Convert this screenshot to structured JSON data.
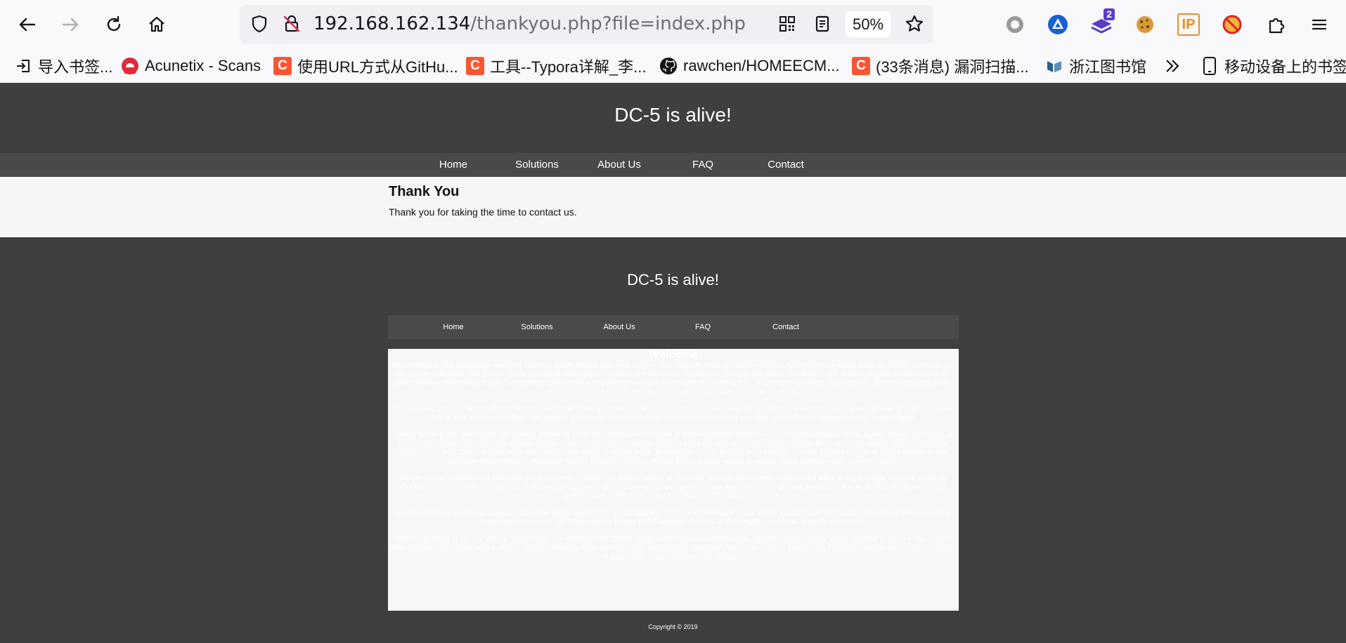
{
  "browser": {
    "url_host": "192.168.162.134",
    "url_path": "/thankyou.php?file=index.php",
    "zoom": "50%",
    "extension_badge": "2",
    "ip_extension_label": "IP",
    "bookmarks": [
      {
        "label": "导入书签...",
        "icon": "import-icon"
      },
      {
        "label": "Acunetix - Scans",
        "icon": "acunetix-icon"
      },
      {
        "label": "使用URL方式从GitHu...",
        "icon": "csdn-icon",
        "icon_text": "C"
      },
      {
        "label": "工具--Typora详解_李...",
        "icon": "csdn-icon",
        "icon_text": "C"
      },
      {
        "label": "rawchen/HOMEECM...",
        "icon": "github-icon"
      },
      {
        "label": "(33条消息) 漏洞扫描...",
        "icon": "csdn-icon",
        "icon_text": "C"
      },
      {
        "label": "浙江图书馆",
        "icon": "library-icon"
      },
      {
        "label": "移动设备上的书签",
        "icon": "mobile-icon"
      }
    ]
  },
  "site": {
    "title": "DC-5 is alive!",
    "nav": [
      "Home",
      "Solutions",
      "About Us",
      "FAQ",
      "Contact"
    ],
    "content": {
      "heading": "Thank You",
      "text": "Thank you for taking the time to contact us."
    },
    "included": {
      "title": "DC-5 is alive!",
      "nav": [
        "Home",
        "Solutions",
        "About Us",
        "FAQ",
        "Contact"
      ],
      "heading": "Welcome",
      "paragraphs": [
        "Duis at dolor a nibh malesuada sagittis id amet orci ipsum. Mauris vitae ante magna. Proin posuere, dolor vel volutpat facilisis, turpis ante malesuada diam, ac efficitur nisi ipsum vel elit. Integer sollicitudin nibh id risus lacinia consequat. Nam aliquet est tellus, non lacinia leo dignissim at. Quisque sed nisl mi. Curabitur a nibh in lacus aliquam tincidunt at vel dui. Etiam tristique malesuada dictum. Suspendisse euismod tellus sed ante tempor, quis elementum nunc elementum. Mauris egestas vitae a tortor volutpat, dignissim interdum justo. Nulla facilisi sed it lobortis semper tempus. In ipsum sagittis eros vitae sociosqu.",
        "Fusce sagittis convallis laoreet. Donec venenatis leo urna. Fusce accumsan nisi a tellus eleifend molestie mollis. Curabitur non nisi placerat augue pharetra, vitae ut odio. Nunc vitae felis ut ante dictum vestibulum. Sed aliquam tortor mollis lectus, sollicitudin id vel fermentum metus sed. Nam a dui vehicula, aliquam ante vel semper ligula.",
        "Integer ipsum purus, elementum non egestas gravida sit amet, accumsan eu nunc. Etiam at ipsum dignissim, tempus arcu consequat, porttitor massa. Nullam tempor eget turpis ut lacus mattis ullamcorper sed porta. Aenean lobortis euismod venenatis commodo. Vivamus porta nisl ante commodo lobortis. Aenean libero lacus nisl lobortis mollis consectetur. Nulla ut nunc ante. Donec a porta justo, vitae facilisis erat. Morbi id semper tellus. Suspendisse cursus porttitor lacus vehicula. Aenean dapibus et enim sit dictum laoreet. In hac habitasse platea dictumst. Maecenas facilisis bibendum tristique. Nullam finibus pulvinar augue at semper. Morbi sed libero quis ornare convallis.",
        "Integer suscipit sodales ex, a bibendum purus rutrum et. Praesent vel dictum, tempor at lorem sed, tristique laoreet ante. Vivamus sed tellus ac turpis feugiat auctor at varius sit. Curabitur tempus est, ac ornare tincidunt pharetra volutpat arcu. Maecenas posuere leo eget erat porta. Aliquam et enim aliquam, vestibulum augue, dapibus libero. Aliquam et pellentesque, mollis turpis non. Ut ut magna sed feugiat, consectetur.",
        "Mauris vel lectus, ultricies ac dapibus. Ut ultricies sapien quis lorem egestas aliquam. Vivamus et malesuada mollis. Fusce ac ante ipsum porta sapien. Phasellus tempus rhoncus turpis, eget elementum nisl. Etiam pulvinar tempor nisl ut dapibus. Vivamus at nibh fringilla enim. Nulla id lacinia elementum.",
        "Vivamus pharetra et nisi sed viverra. Suspendisse non eleifend enim. Donec dapibus venenatis est ut ornare nulla. Aliquam massa tristique augue, eleifend at ultricies nec, semper felis. Quisque ullamcorper justo in dictum dignissim aliquam. Nulla eget tortor quis pellentesque consequat. Maecenas et lorem faucibus elit. Praesent molestie sed ac justo convallis. Ut scelerisque ornare lobortis in nisl dignissim."
      ],
      "copyright": "Copyright © 2019"
    }
  }
}
